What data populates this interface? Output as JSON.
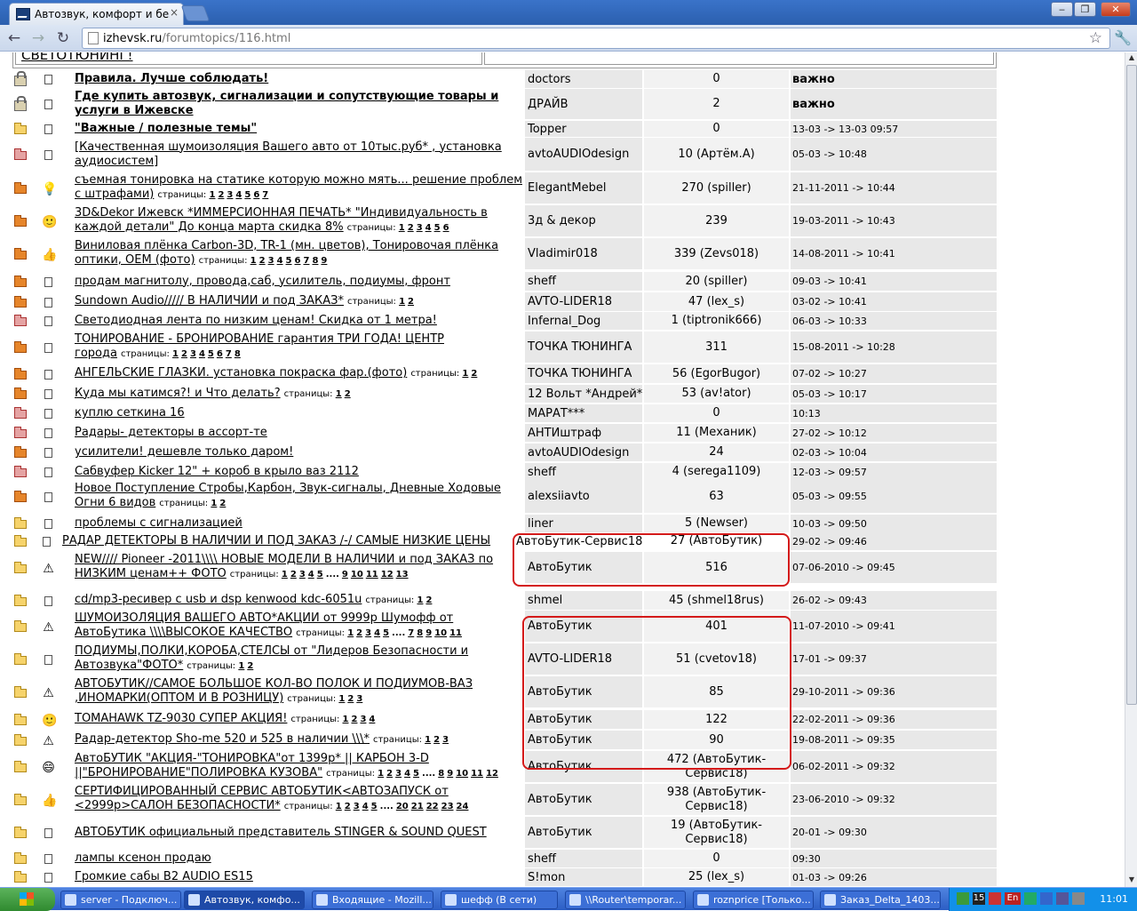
{
  "browser": {
    "tab_title": "Автозвук, комфорт и безопа",
    "url_host": "izhevsk.ru",
    "url_path": "/forumtopics/116.html",
    "close_glyph": "×"
  },
  "window_buttons": {
    "minimize": "‒",
    "maximize": "❐",
    "close": "✕"
  },
  "nav": {
    "back": "←",
    "forward": "→",
    "reload": "↻",
    "star": "☆",
    "wrench": "🔧"
  },
  "forum": {
    "header_title": "СВЕТОТЮНИНГ!",
    "topics": [
      {
        "icon": "lock",
        "emo": "doc",
        "title": "Правила. Лучше соблюдать!",
        "bold": true,
        "pages": [],
        "author": "doctors",
        "replies": "0",
        "date": "важно",
        "date_bold": true
      },
      {
        "icon": "lock",
        "emo": "doc",
        "title": "Где купить автозвук, сигнализации и сопутствующие товары и услуги в Ижевске",
        "bold": true,
        "pages": [],
        "author": "ДРАЙВ",
        "replies": "2",
        "date": "важно",
        "date_bold": true
      },
      {
        "icon": "folder",
        "emo": "doc",
        "title": "\"Важные / полезные темы\"",
        "bold": true,
        "pages": [],
        "author": "Topper",
        "replies": "0",
        "date": "13-03 -> 13-03 09:57"
      },
      {
        "icon": "folder-red",
        "emo": "doc",
        "title": "[Качественная шумоизоляция Вашего авто от 10тыс.руб* , установка аудиосистем]",
        "bold": false,
        "pages": [],
        "author": "avtoAUDIOdesign",
        "replies": "10 (Артём.А)",
        "date": "05-03 -> 10:48"
      },
      {
        "icon": "folder-hot",
        "emo": "bulb",
        "title": "съемная тонировка на статике которую можно мять... решение проблем с штрафами)",
        "bold": false,
        "pages": [
          "1",
          "2",
          "3",
          "4",
          "5",
          "6",
          "7"
        ],
        "author": "ElegantMebel",
        "replies": "270 (spiller)",
        "date": "21-11-2011 -> 10:44"
      },
      {
        "icon": "folder-hot",
        "emo": "smile",
        "title": "3D&Dekor Ижевск *ИММЕРСИОННАЯ ПЕЧАТЬ* \"Индивидуальность в каждой детали\" До конца марта скидка 8%",
        "bold": false,
        "pages": [
          "1",
          "2",
          "3",
          "4",
          "5",
          "6"
        ],
        "author": "3д & декор",
        "replies": "239",
        "date": "19-03-2011 -> 10:43"
      },
      {
        "icon": "folder-hot",
        "emo": "thumb",
        "title": "Виниловая плёнка Carbon-3D, TR-1 (мн. цветов), Тонировочая плёнка оптики, OEM (фото)",
        "bold": false,
        "pages": [
          "1",
          "2",
          "3",
          "4",
          "5",
          "6",
          "7",
          "8",
          "9"
        ],
        "author": "Vladimir018",
        "replies": "339 (Zevs018)",
        "date": "14-08-2011 -> 10:41"
      },
      {
        "icon": "folder-hot",
        "emo": "doc",
        "title": "продам магнитолу, провода,саб, усилитель, подиумы, фронт",
        "bold": false,
        "pages": [],
        "author": "sheff",
        "replies": "20 (spiller)",
        "date": "09-03 -> 10:41"
      },
      {
        "icon": "folder-hot",
        "emo": "doc",
        "title": "Sundown Audio///// В НАЛИЧИИ и под ЗАКАЗ*",
        "bold": false,
        "pages": [
          "1",
          "2"
        ],
        "author": "AVTO-LIDER18",
        "replies": "47 (lex_s)",
        "date": "03-02 -> 10:41"
      },
      {
        "icon": "folder-red",
        "emo": "doc",
        "title": "Светодиодная лента по низким ценам! Скидка от 1 метра!",
        "bold": false,
        "pages": [],
        "author": "Infernal_Dog",
        "replies": "1 (tiptronik666)",
        "date": "06-03 -> 10:33"
      },
      {
        "icon": "folder-hot",
        "emo": "doc",
        "title": "ТОНИРОВАНИЕ - БРОНИРОВАНИЕ гарантия ТРИ ГОДА! ЦЕНТР города",
        "bold": false,
        "pages": [
          "1",
          "2",
          "3",
          "4",
          "5",
          "6",
          "7",
          "8"
        ],
        "author": "ТОЧКА ТЮНИНГА",
        "replies": "311",
        "date": "15-08-2011 -> 10:28"
      },
      {
        "icon": "folder-hot",
        "emo": "doc",
        "title": "АНГЕЛЬСКИЕ ГЛАЗКИ. установка покраска фар.(фото)",
        "bold": false,
        "pages": [
          "1",
          "2"
        ],
        "author": "ТОЧКА ТЮНИНГА",
        "replies": "56 (EgorBugor)",
        "date": "07-02 -> 10:27"
      },
      {
        "icon": "folder-hot",
        "emo": "doc",
        "title": "Куда мы катимся?! и Что делать?",
        "bold": false,
        "pages": [
          "1",
          "2"
        ],
        "author": "12 Вольт *Андрей*",
        "replies": "53 (av!ator)",
        "date": "05-03 -> 10:17"
      },
      {
        "icon": "folder-red",
        "emo": "doc",
        "title": "куплю сеткина 16",
        "bold": false,
        "pages": [],
        "author": "МАРАТ***",
        "replies": "0",
        "date": "10:13"
      },
      {
        "icon": "folder-red",
        "emo": "doc",
        "title": "Радары- детекторы в ассорт-те",
        "bold": false,
        "pages": [],
        "author": "АНТИштраф",
        "replies": "11 (Механик)",
        "date": "27-02 -> 10:12"
      },
      {
        "icon": "folder-hot",
        "emo": "doc",
        "title": "усилители! дешевле только даром!",
        "bold": false,
        "pages": [],
        "author": "avtoAUDIOdesign",
        "replies": "24",
        "date": "02-03 -> 10:04"
      },
      {
        "icon": "folder-red",
        "emo": "doc",
        "title": "Сабвуфер Kicker 12\" + короб в крыло ваз 2112",
        "bold": false,
        "pages": [],
        "author": "sheff",
        "replies": "4 (serega1109)",
        "date": "12-03 -> 09:57"
      },
      {
        "icon": "folder-hot",
        "emo": "doc",
        "title": "Новое Поступление Стробы,Карбон, Звук-сигналы, Дневные Ходовые Огни 6 видов",
        "bold": false,
        "pages": [
          "1",
          "2"
        ],
        "author": "alexsiiavto",
        "replies": "63",
        "date": "05-03 -> 09:55"
      },
      {
        "icon": "folder",
        "emo": "doc",
        "title": "проблемы с сигнализацией",
        "bold": false,
        "pages": [],
        "author": "liner",
        "replies": "5 (Newser)",
        "date": "10-03 -> 09:50"
      },
      {
        "icon": "folder",
        "emo": "doc",
        "title": "РАДАР ДЕТЕКТОРЫ В НАЛИЧИИ И ПОД ЗАКАЗ /-/ САМЫЕ НИЗКИЕ ЦЕНЫ",
        "bold": false,
        "pages": [],
        "author": "АвтоБутик-Сервис18",
        "replies": "27 (АвтоБутик)",
        "date": "29-02 -> 09:46",
        "shifted": true
      },
      {
        "icon": "folder",
        "emo": "warn",
        "title": "NEW//// Pioneer -2011\\\\\\\\ НОВЫЕ МОДЕЛИ В НАЛИЧИИ и под ЗАКАЗ по НИЗКИМ ценам++ ФОТО",
        "bold": false,
        "pages": [
          "1",
          "2",
          "3",
          "4",
          "5",
          "....",
          "9",
          "10",
          "11",
          "12",
          "13"
        ],
        "author": "АвтоБутик",
        "replies": "516",
        "date": "07-06-2010 -> 09:45"
      },
      {
        "icon": "folder",
        "emo": "doc",
        "title": "cd/mp3-ресивер с usb и dsp kenwood kdc-6051u",
        "bold": false,
        "pages": [
          "1",
          "2"
        ],
        "author": "shmel",
        "replies": "45 (shmel18rus)",
        "date": "26-02 -> 09:43"
      },
      {
        "icon": "folder",
        "emo": "warn",
        "title": "ШУМОИЗОЛЯЦИЯ ВАШЕГО АВТО*АКЦИИ от 9999р Шумофф от АвтоБутика \\\\\\\\ВЫСОКОЕ КАЧЕСТВО",
        "bold": false,
        "pages": [
          "1",
          "2",
          "3",
          "4",
          "5",
          "....",
          "7",
          "8",
          "9",
          "10",
          "11"
        ],
        "author": "АвтоБутик",
        "replies": "401",
        "date": "11-07-2010 -> 09:41"
      },
      {
        "icon": "folder",
        "emo": "doc",
        "title": "ПОДИУМЫ,ПОЛКИ,КОРОБА,СТЕЛСЫ от \"Лидеров Безопасности и Автозвука\"ФОТО*",
        "bold": false,
        "pages": [
          "1",
          "2"
        ],
        "author": "AVTO-LIDER18",
        "replies": "51 (cvetov18)",
        "date": "17-01 -> 09:37"
      },
      {
        "icon": "folder",
        "emo": "warn",
        "title": "АВТОБУТИК//САМОЕ БОЛЬШОЕ КОЛ-ВО ПОЛОК И ПОДИУМОВ-ВАЗ ,ИНОМАРКИ(ОПТОМ И В РОЗНИЦУ)",
        "bold": false,
        "pages": [
          "1",
          "2",
          "3"
        ],
        "author": "АвтоБутик",
        "replies": "85",
        "date": "29-10-2011 -> 09:36"
      },
      {
        "icon": "folder",
        "emo": "smile",
        "title": "TOMAHAWK TZ-9030 СУПЕР АКЦИЯ!",
        "bold": false,
        "pages": [
          "1",
          "2",
          "3",
          "4"
        ],
        "author": "АвтоБутик",
        "replies": "122",
        "date": "22-02-2011 -> 09:36"
      },
      {
        "icon": "folder",
        "emo": "warn",
        "title": "Радар-детектор Sho-me 520 и 525 в наличии \\\\\\*",
        "bold": false,
        "pages": [
          "1",
          "2",
          "3"
        ],
        "author": "АвтоБутик",
        "replies": "90",
        "date": "19-08-2011 -> 09:35"
      },
      {
        "icon": "folder",
        "emo": "grin",
        "title": "АвтоБУТИК \"АКЦИЯ-\"ТОНИРОВКА\"от 1399р* || КАРБОН 3-D ||\"БРОНИРОВАНИЕ\"ПОЛИРОВКА КУЗОВА\"",
        "bold": false,
        "pages": [
          "1",
          "2",
          "3",
          "4",
          "5",
          "....",
          "8",
          "9",
          "10",
          "11",
          "12"
        ],
        "author": "АвтоБутик",
        "replies": "472 (АвтоБутик-Сервис18)",
        "date": "06-02-2011 -> 09:32"
      },
      {
        "icon": "folder",
        "emo": "thumb",
        "title": "СЕРТИФИЦИРОВАННЫЙ СЕРВИС АВТОБУТИК<АВТОЗАПУСК от <2999р>САЛОН БЕЗОПАСНОСТИ*",
        "bold": false,
        "pages": [
          "1",
          "2",
          "3",
          "4",
          "5",
          "....",
          "20",
          "21",
          "22",
          "23",
          "24"
        ],
        "author": "АвтоБутик",
        "replies": "938 (АвтоБутик-Сервис18)",
        "date": "23-06-2010 -> 09:32"
      },
      {
        "icon": "folder",
        "emo": "doc",
        "title": "АВТОБУТИК официальный представитель STINGER & SOUND QUEST",
        "bold": false,
        "pages": [],
        "author": "АвтоБутик",
        "replies": "19 (АвтоБутик-Сервис18)",
        "date": "20-01 -> 09:30"
      },
      {
        "icon": "folder",
        "emo": "doc",
        "title": "лампы ксенон продаю",
        "bold": false,
        "pages": [],
        "author": "sheff",
        "replies": "0",
        "date": "09:30"
      },
      {
        "icon": "folder",
        "emo": "doc",
        "title": "Громкие сабы B2 AUDIO ES15",
        "bold": false,
        "pages": [],
        "author": "S!mon",
        "replies": "25 (lex_s)",
        "date": "01-03 -> 09:26"
      }
    ],
    "pages_label": "страницы:"
  },
  "taskbar": {
    "tasks": [
      {
        "label": "server - Подключ...",
        "active": false
      },
      {
        "label": "Автозвук, комфо...",
        "active": true
      },
      {
        "label": "Входящие - Mozill...",
        "active": false
      },
      {
        "label": "шефф (В сети)",
        "active": false
      },
      {
        "label": "\\\\Router\\temporar...",
        "active": false
      },
      {
        "label": "roznprice [Только...",
        "active": false
      },
      {
        "label": "Заказ_Delta_1403...",
        "active": false
      }
    ],
    "tray_items": [
      "15",
      "En"
    ],
    "clock": "11:01"
  }
}
